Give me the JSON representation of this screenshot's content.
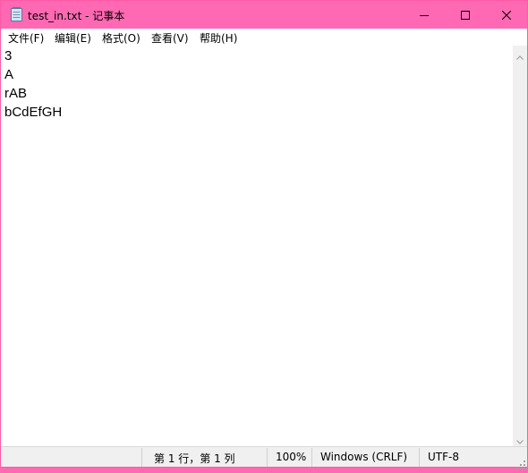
{
  "window": {
    "title": "test_in.txt - 记事本"
  },
  "menu": {
    "items": [
      {
        "label": "文件(F)"
      },
      {
        "label": "编辑(E)"
      },
      {
        "label": "格式(O)"
      },
      {
        "label": "查看(V)"
      },
      {
        "label": "帮助(H)"
      }
    ]
  },
  "editor": {
    "lines": [
      "3",
      "A",
      "rAB",
      "bCdEfGH"
    ]
  },
  "status": {
    "position": "第 1 行，第 1 列",
    "zoom": "100%",
    "line_ending": "Windows (CRLF)",
    "encoding": "UTF-8"
  },
  "theme": {
    "titlebar_color": "#ff69b4"
  },
  "icons": {
    "app": "notepad-icon",
    "minimize": "minimize-icon",
    "maximize": "maximize-icon",
    "close": "close-icon",
    "scroll_up": "chevron-up-icon",
    "scroll_down": "chevron-down-icon",
    "resize": "resize-grip-icon"
  }
}
